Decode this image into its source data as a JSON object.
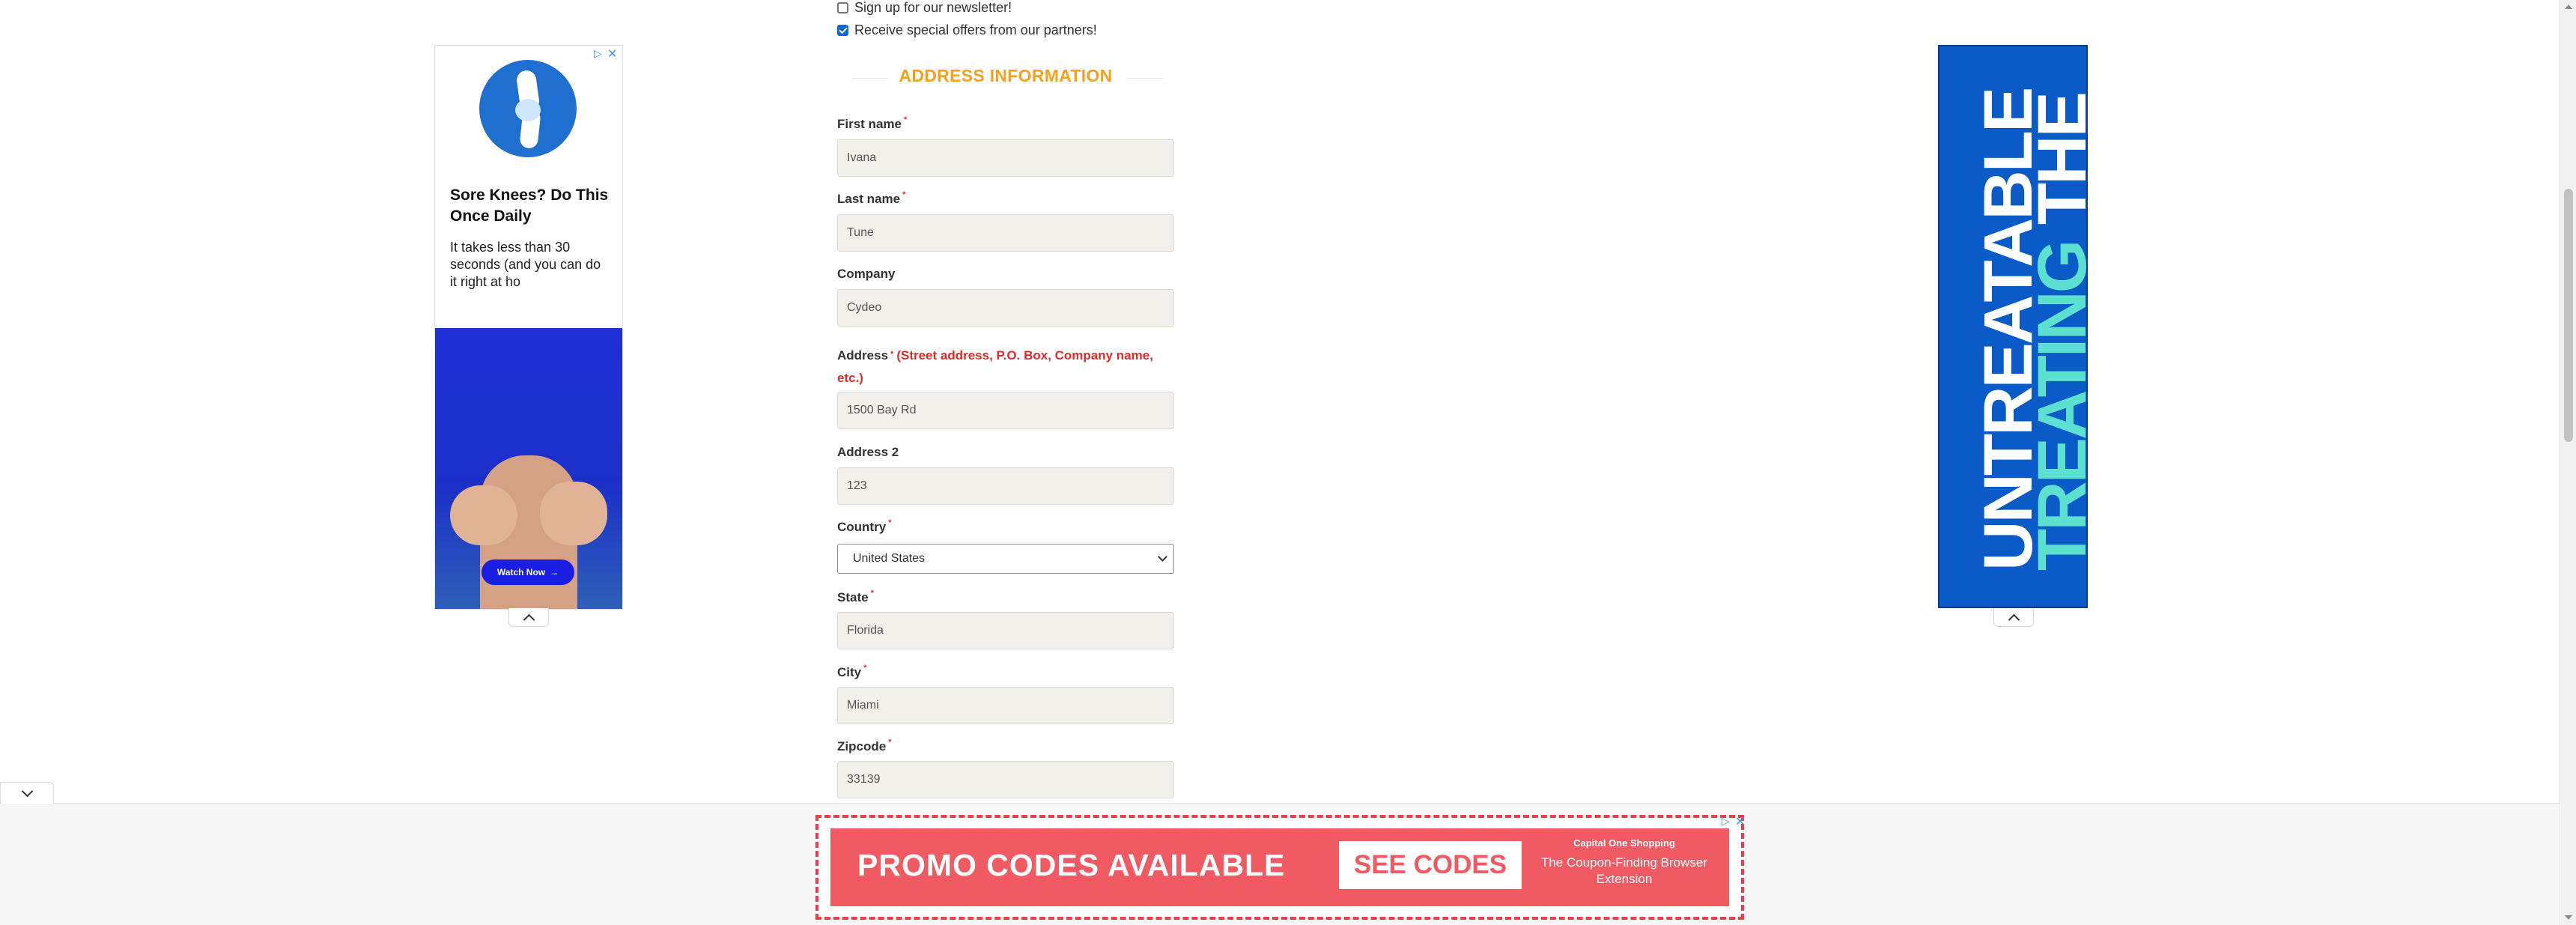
{
  "checkboxes": [
    {
      "label": "Sign up for our newsletter!",
      "checked": false
    },
    {
      "label": "Receive special offers from our partners!",
      "checked": true
    }
  ],
  "section_title": "ADDRESS INFORMATION",
  "required_marker": "*",
  "fields": {
    "first_name": {
      "label": "First name",
      "value": "Ivana",
      "required": true
    },
    "last_name": {
      "label": "Last name",
      "value": "Tune",
      "required": true
    },
    "company": {
      "label": "Company",
      "value": "Cydeo",
      "required": false
    },
    "address": {
      "label": "Address",
      "note": "(Street address, P.O. Box, Company name,",
      "note2": "etc.)",
      "value": "1500 Bay Rd",
      "required": true
    },
    "address2": {
      "label": "Address 2",
      "value": "123",
      "required": false
    },
    "country": {
      "label": "Country",
      "value": "United States",
      "required": true
    },
    "state": {
      "label": "State",
      "value": "Florida",
      "required": true
    },
    "city": {
      "label": "City",
      "value": "Miami",
      "required": true
    },
    "zipcode": {
      "label": "Zipcode",
      "value": "33139",
      "required": true
    }
  },
  "ad_left": {
    "headline": "Sore Knees? Do This Once Daily",
    "body": "It takes less than 30 seconds (and you can do it right at ho",
    "cta": "Watch Now"
  },
  "ad_right": {
    "line1": "TREATING THE",
    "line2": "UNTREATABLE",
    "line1_accent": "TREATING"
  },
  "ad_bottom": {
    "promo": "PROMO CODES AVAILABLE",
    "cta": "SEE CODES",
    "brand": "Capital One Shopping",
    "tagline": "The Coupon-Finding Browser Extension"
  },
  "colors": {
    "section_title": "#f5a01f",
    "required": "#e02b27",
    "field_bg": "#f1f0ea",
    "ad_right_bg": "#0a5ac7",
    "ad_right_accent": "#5ce1d0",
    "promo_bg": "#f05a63"
  },
  "icons": [
    "adchoices-icon",
    "close-icon",
    "chevron-up-icon",
    "chevron-down-icon",
    "knee-joint-icon",
    "arrow-right-icon"
  ]
}
